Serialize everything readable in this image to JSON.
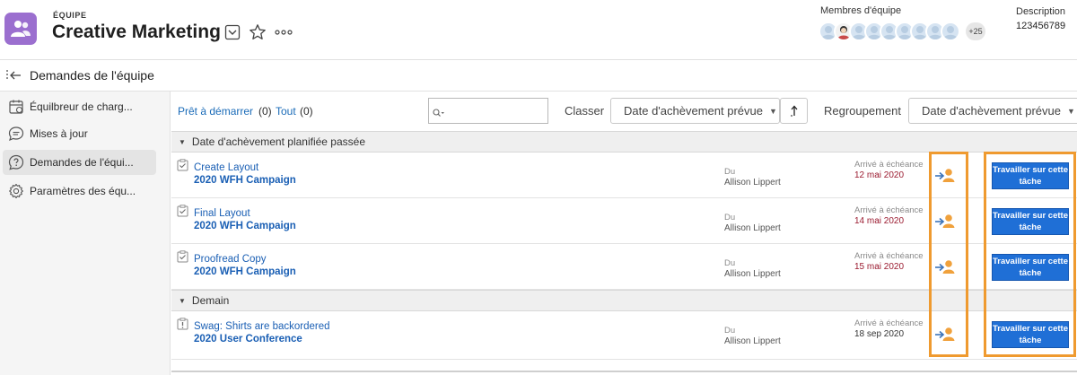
{
  "header": {
    "kicker": "ÉQUIPE",
    "title": "Creative Marketing",
    "members_label": "Membres d'équipe",
    "members_more": "+25",
    "description_label": "Description",
    "description_value": "123456789",
    "team_avatar_color": "#9b6fcf"
  },
  "subheader": {
    "title": "Demandes de l'équipe"
  },
  "sidebar": {
    "items": [
      {
        "label": "Équilbreur de charg...",
        "icon": "calendar-icon"
      },
      {
        "label": "Mises à jour",
        "icon": "chat-icon"
      },
      {
        "label": "Demandes de l'équi...",
        "icon": "question-icon"
      },
      {
        "label": "Paramètres des équ...",
        "icon": "gear-icon"
      }
    ]
  },
  "toolbar": {
    "filter_ready_label": "Prêt à démarrer",
    "filter_ready_count": "(0)",
    "filter_all_label": "Tout",
    "filter_all_count": "(0)",
    "search_value": "",
    "sort_label": "Classer",
    "sort_value": "Date d'achèvement prévue",
    "group_label": "Regroupement",
    "group_value": "Date d'achèvement prévue"
  },
  "groups": [
    {
      "label": "Date d'achèvement planifiée passée",
      "rows": [
        {
          "task": "Create Layout",
          "project": "2020 WFH Campaign",
          "from_label": "Du",
          "from_name": "Allison Lippert",
          "due_label": "Arrivé à échéance",
          "due_date": "12 mai 2020",
          "overdue": true,
          "button": "Travailler sur cette tâche"
        },
        {
          "task": "Final Layout",
          "project": "2020 WFH Campaign",
          "from_label": "Du",
          "from_name": "Allison Lippert",
          "due_label": "Arrivé à échéance",
          "due_date": "14 mai 2020",
          "overdue": true,
          "button": "Travailler sur cette tâche"
        },
        {
          "task": "Proofread Copy",
          "project": "2020 WFH Campaign",
          "from_label": "Du",
          "from_name": "Allison Lippert",
          "due_label": "Arrivé à échéance",
          "due_date": "15 mai 2020",
          "overdue": true,
          "button": "Travailler sur cette tâche"
        }
      ]
    },
    {
      "label": "Demain",
      "rows": [
        {
          "task": "Swag: Shirts are backordered",
          "project": "2020 User Conference",
          "from_label": "Du",
          "from_name": "Allison Lippert",
          "due_label": "Arrivé à échéance",
          "due_date": "18 sep 2020",
          "overdue": false,
          "button": "Travailler sur cette tâche"
        }
      ]
    }
  ],
  "colors": {
    "link": "#1a5fb4",
    "overdue": "#9b1b30",
    "button": "#1f6fd6",
    "highlight": "#ef9a2f"
  }
}
